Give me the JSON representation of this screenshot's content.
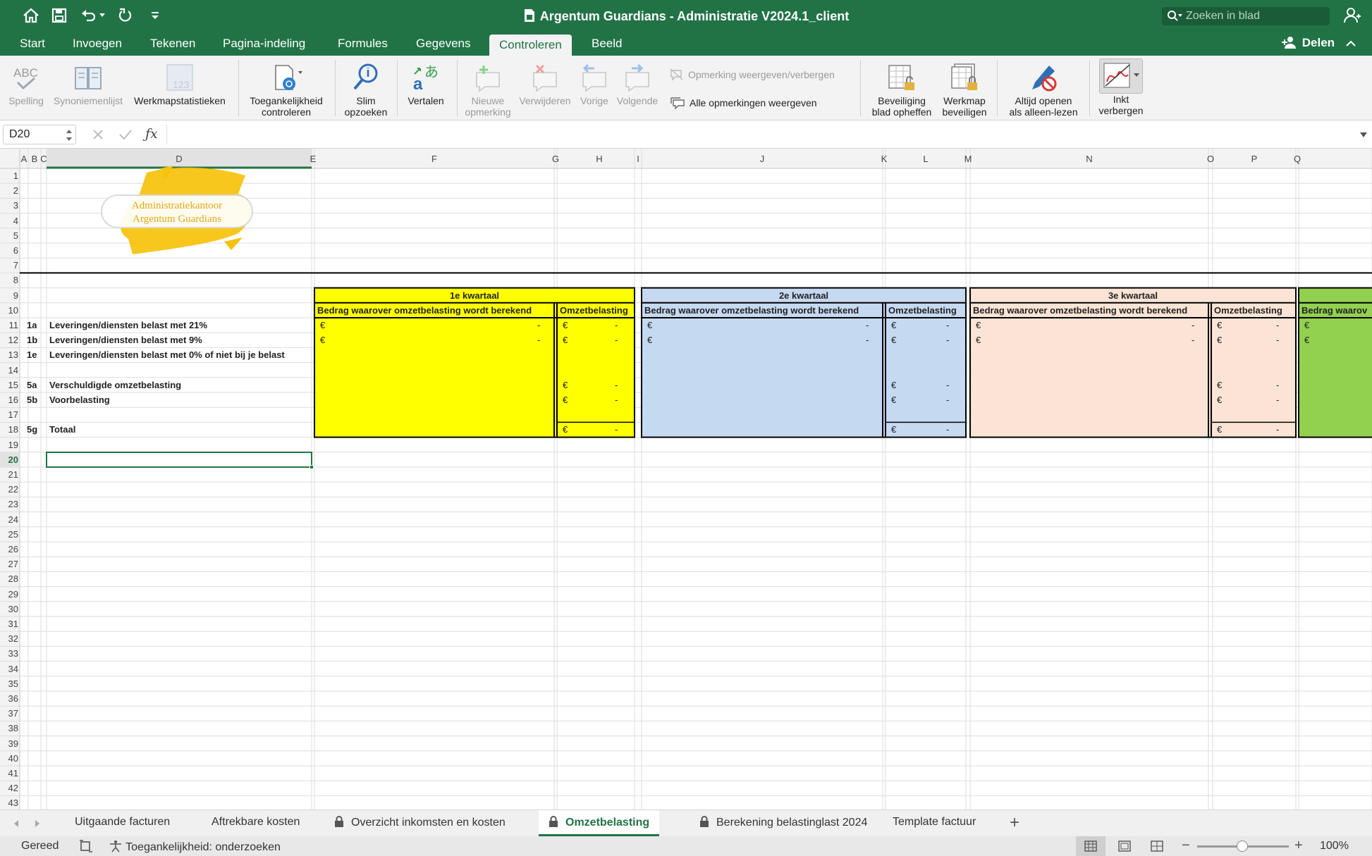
{
  "window": {
    "title": "Argentum Guardians - Administratie V2024.1_client",
    "search_placeholder": "Zoeken in blad",
    "share_label": "Delen"
  },
  "menu_tabs": [
    "Start",
    "Invoegen",
    "Tekenen",
    "Pagina-indeling",
    "Formules",
    "Gegevens",
    "Controleren",
    "Beeld"
  ],
  "active_menu_tab": "Controleren",
  "ribbon": {
    "spelling": "Spelling",
    "thesaurus": "Synoniemenlijst",
    "stats": "Werkmapstatistieken",
    "accessibility": [
      "Toegankelijkheid",
      "controleren"
    ],
    "smart_lookup": [
      "Slim",
      "opzoeken"
    ],
    "translate": "Vertalen",
    "new_comment": [
      "Nieuwe",
      "opmerking"
    ],
    "delete": "Verwijderen",
    "previous": "Vorige",
    "next": "Volgende",
    "show_hide_comment": "Opmerking weergeven/verbergen",
    "show_all_comments": "Alle opmerkingen weergeven",
    "unprotect_sheet": [
      "Beveiliging",
      "blad opheffen"
    ],
    "protect_workbook": [
      "Werkmap",
      "beveiligen"
    ],
    "always_open_readonly": [
      "Altijd openen",
      "als alleen-lezen"
    ],
    "hide_ink": [
      "Inkt",
      "verbergen"
    ]
  },
  "name_box": "D20",
  "logo_text": [
    "Administratiekantoor",
    "Argentum Guardians"
  ],
  "col_headers": [
    "A",
    "B",
    "C",
    "D",
    "E",
    "F",
    "G",
    "H",
    "I",
    "J",
    "K",
    "L",
    "M",
    "N",
    "O",
    "P",
    "Q"
  ],
  "row_numbers": [
    "1",
    "2",
    "3",
    "4",
    "5",
    "6",
    "7",
    "8",
    "9",
    "10",
    "11",
    "12",
    "13",
    "14",
    "15",
    "16",
    "17",
    "18",
    "19",
    "20",
    "21",
    "22",
    "23",
    "24",
    "25",
    "26",
    "27",
    "28",
    "29",
    "30",
    "31",
    "32",
    "33",
    "34",
    "35",
    "36",
    "37",
    "38",
    "39",
    "40",
    "41",
    "42",
    "43"
  ],
  "tax_rows": [
    {
      "row": "11",
      "code": "1a",
      "label": "Leveringen/diensten belast met 21%",
      "amount": true,
      "tax": true
    },
    {
      "row": "12",
      "code": "1b",
      "label": "Leveringen/diensten belast met 9%",
      "amount": true,
      "tax": true
    },
    {
      "row": "13",
      "code": "1e",
      "label": "Leveringen/diensten belast met 0% of niet bij je belast",
      "amount": false,
      "tax": false
    },
    {
      "row": "15",
      "code": "5a",
      "label": "Verschuldigde omzetbelasting",
      "amount": false,
      "tax": true
    },
    {
      "row": "16",
      "code": "5b",
      "label": "Voorbelasting",
      "amount": false,
      "tax": true
    },
    {
      "row": "18",
      "code": "5g",
      "label": "Totaal",
      "amount": false,
      "tax": true
    }
  ],
  "quarters": [
    {
      "name": "1e kwartaal",
      "color": "#ffff00"
    },
    {
      "name": "2e kwartaal",
      "color": "#c5d9f1"
    },
    {
      "name": "3e kwartaal",
      "color": "#fbe4d5"
    },
    {
      "name": "",
      "color": "#92d050"
    }
  ],
  "amount_header": "Bedrag waarover omzetbelasting wordt berekend",
  "amount_header_cut": "Bedrag waarov",
  "tax_header": "Omzetbelasting",
  "currency": "€",
  "empty_value": "-",
  "sheet_tabs": [
    {
      "label": "Uitgaande facturen",
      "locked": false
    },
    {
      "label": "Aftrekbare kosten",
      "locked": false
    },
    {
      "label": "Overzicht inkomsten en kosten",
      "locked": true
    },
    {
      "label": "Omzetbelasting",
      "locked": true,
      "active": true
    },
    {
      "label": "Berekening belastinglast 2024",
      "locked": true
    },
    {
      "label": "Template factuur",
      "locked": false
    }
  ],
  "status": {
    "ready": "Gereed",
    "accessibility": "Toegankelijkheid: onderzoeken",
    "zoom": "100%"
  }
}
